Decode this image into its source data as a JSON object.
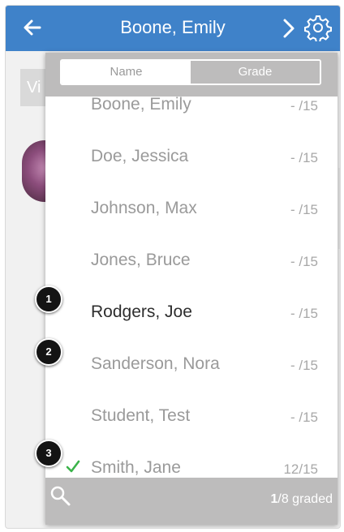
{
  "header": {
    "title": "Boone, Emily"
  },
  "underlay": {
    "chip_text": "Vi"
  },
  "segment": {
    "name_label": "Name",
    "grade_label": "Grade",
    "selected": "Grade"
  },
  "students": [
    {
      "name": "Boone, Emily",
      "score": "- /15",
      "graded": false,
      "partially_visible": true
    },
    {
      "name": "Doe, Jessica",
      "score": "- /15",
      "graded": false
    },
    {
      "name": "Johnson, Max",
      "score": "- /15",
      "graded": false
    },
    {
      "name": "Jones, Bruce",
      "score": "- /15",
      "graded": false
    },
    {
      "name": "Rodgers, Joe",
      "score": "- /15",
      "graded": false,
      "active": true
    },
    {
      "name": "Sanderson, Nora",
      "score": "- /15",
      "graded": false
    },
    {
      "name": "Student, Test",
      "score": "- /15",
      "graded": false
    },
    {
      "name": "Smith, Jane",
      "score": "12/15",
      "graded": true
    }
  ],
  "callouts": [
    "1",
    "2",
    "3"
  ],
  "footer": {
    "graded_count": "1",
    "graded_suffix": "/8 graded"
  },
  "colors": {
    "header_blue": "#3f82c9",
    "bar_gray": "#bdbcbc",
    "check_green": "#3bb34a"
  },
  "icons": {
    "back": "arrow-left-icon",
    "next": "chevron-right-icon",
    "settings": "gear-icon",
    "search": "search-icon",
    "graded": "checkmark-icon"
  }
}
